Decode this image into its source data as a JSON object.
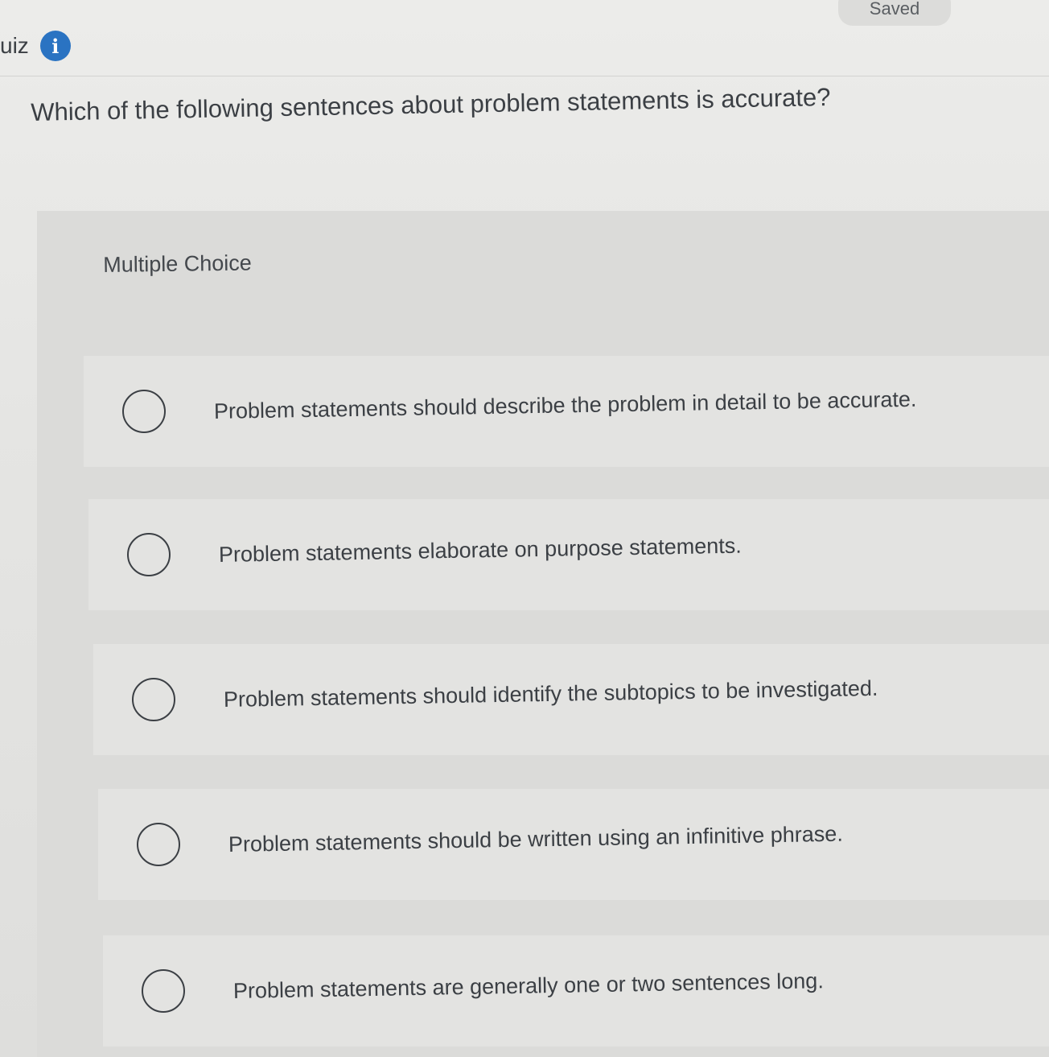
{
  "header": {
    "quiz_label": "uiz",
    "info_icon": "info-icon",
    "saved_label": "Saved"
  },
  "question": {
    "text": "Which of the following sentences about problem statements is accurate?",
    "type_label": "Multiple Choice"
  },
  "options": [
    {
      "text": "Problem statements should describe the problem in detail to be accurate.",
      "selected": false
    },
    {
      "text": "Problem statements elaborate on purpose statements.",
      "selected": false
    },
    {
      "text": "Problem statements should identify the subtopics to be investigated.",
      "selected": false
    },
    {
      "text": "Problem statements should be written using an infinitive phrase.",
      "selected": false
    },
    {
      "text": "Problem statements are generally one or two sentences long.",
      "selected": false
    }
  ],
  "colors": {
    "accent": "#2a73c2",
    "text": "#3b3f44"
  }
}
